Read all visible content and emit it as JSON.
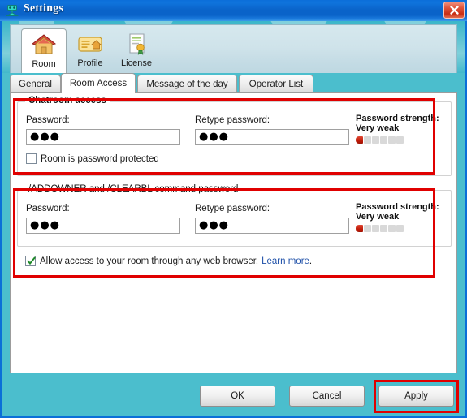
{
  "window": {
    "title": "Settings",
    "icon": "settings-robot-icon",
    "close_label": "×",
    "accent_titlebar": "#0a63c9",
    "accent_body": "#4bbecd"
  },
  "toolbar": {
    "items": [
      {
        "label": "Room",
        "icon": "house-icon",
        "selected": true
      },
      {
        "label": "Profile",
        "icon": "id-card-icon",
        "selected": false
      },
      {
        "label": "License",
        "icon": "certificate-icon",
        "selected": false
      }
    ]
  },
  "tabs": {
    "items": [
      {
        "label": "General",
        "active": false
      },
      {
        "label": "Room Access",
        "active": true
      },
      {
        "label": "Message of the day",
        "active": false
      },
      {
        "label": "Operator List",
        "active": false
      }
    ]
  },
  "groups": [
    {
      "title": "Chatroom access",
      "bold_title": true,
      "password_label": "Password:",
      "password_value": "●●●",
      "retype_label": "Retype password:",
      "retype_value": "●●●",
      "strength_caption": "Password strength:",
      "strength_value": "Very weak",
      "strength_filled": 1,
      "strength_total": 6,
      "strength_color": "#c01a08"
    },
    {
      "title": "/ADDOWNER and /CLEARBL command password",
      "bold_title": false,
      "password_label": "Password:",
      "password_value": "●●●",
      "retype_label": "Retype password:",
      "retype_value": "●●●",
      "strength_caption": "Password strength:",
      "strength_value": "Very weak",
      "strength_filled": 1,
      "strength_total": 6,
      "strength_color": "#c01a08"
    }
  ],
  "checkboxes": {
    "room_protected": {
      "label": "Room is password protected",
      "checked": false
    },
    "web_access": {
      "label": "Allow access to your room through any web browser.",
      "link_label": "Learn more",
      "trailing": ".",
      "checked": true
    }
  },
  "footer": {
    "ok_label": "OK",
    "cancel_label": "Cancel",
    "apply_label": "Apply"
  },
  "annotations": {
    "color": "#e00000",
    "boxes": [
      "chatroom-access-group",
      "command-password-group",
      "apply-button"
    ]
  }
}
